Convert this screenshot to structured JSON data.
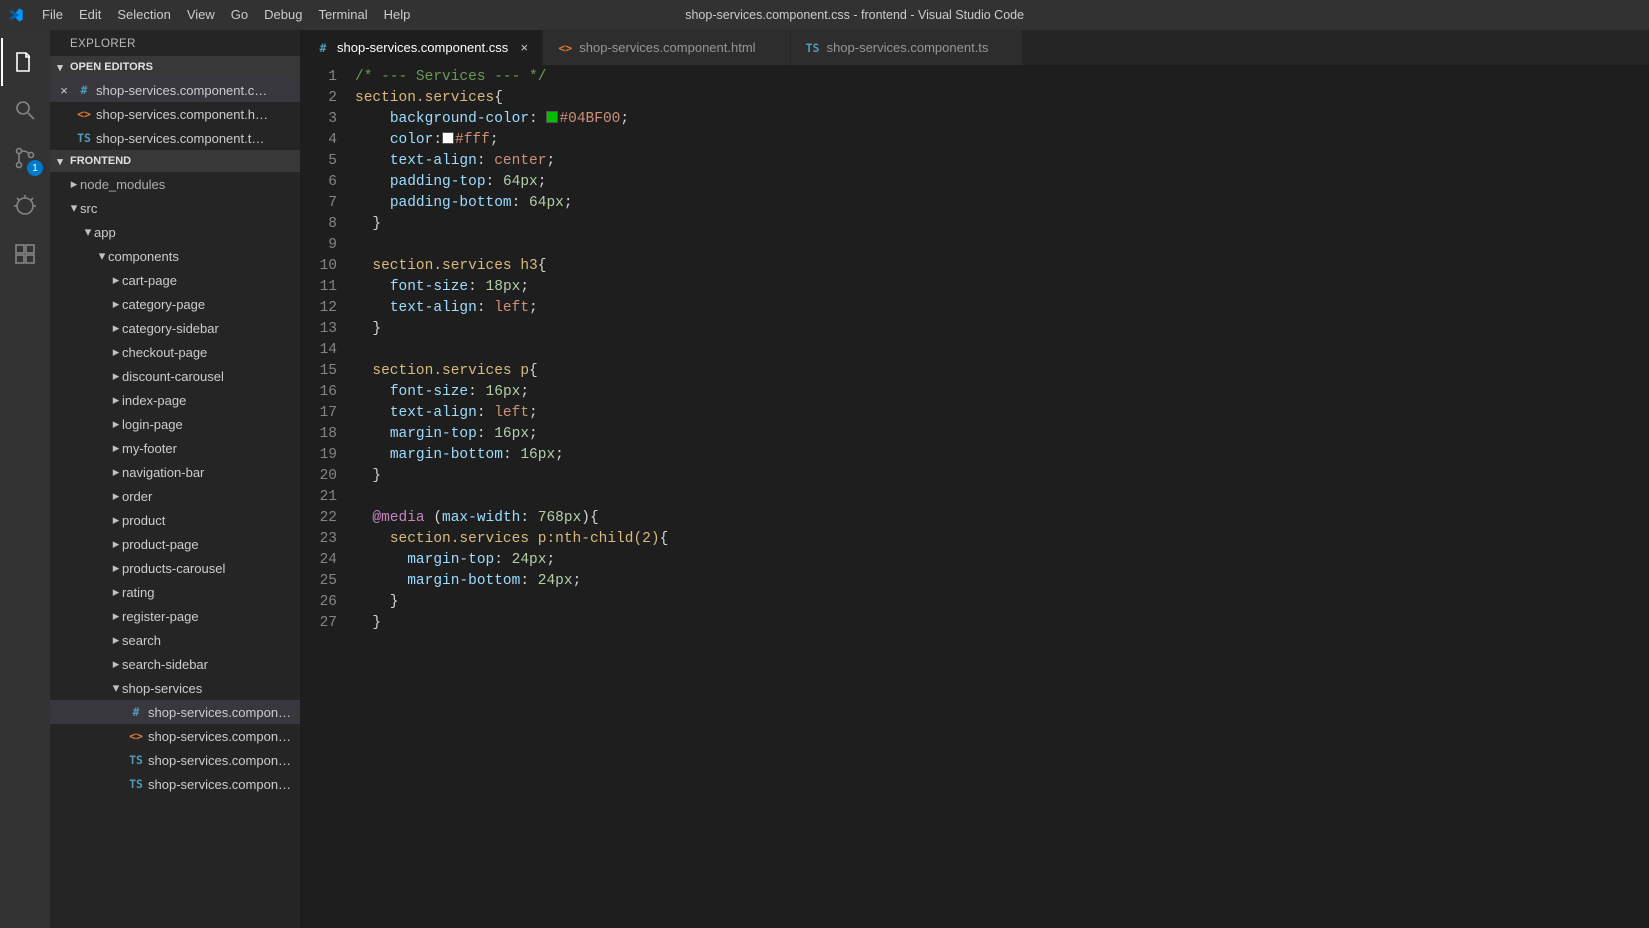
{
  "window_title": "shop-services.component.css - frontend - Visual Studio Code",
  "menu": [
    "File",
    "Edit",
    "Selection",
    "View",
    "Go",
    "Debug",
    "Terminal",
    "Help"
  ],
  "activity": {
    "scm_badge": "1"
  },
  "sidebar": {
    "explorer_label": "EXPLORER",
    "open_editors_label": "OPEN EDITORS",
    "project_label": "FRONTEND",
    "open_editors": [
      {
        "name": "shop-services.component.c…",
        "icon": "#",
        "icoClass": "ico-css",
        "modified": true
      },
      {
        "name": "shop-services.component.h…",
        "icon": "<>",
        "icoClass": "ico-html",
        "modified": false
      },
      {
        "name": "shop-services.component.t…",
        "icon": "TS",
        "icoClass": "ico-ts",
        "modified": false
      }
    ],
    "nodes": [
      {
        "depth": 1,
        "expand": "▸",
        "label": "node_modules",
        "kind": "folder",
        "muted": true
      },
      {
        "depth": 1,
        "expand": "▾",
        "label": "src",
        "kind": "folder"
      },
      {
        "depth": 2,
        "expand": "▾",
        "label": "app",
        "kind": "folder"
      },
      {
        "depth": 3,
        "expand": "▾",
        "label": "components",
        "kind": "folder"
      },
      {
        "depth": 4,
        "expand": "▸",
        "label": "cart-page",
        "kind": "folder"
      },
      {
        "depth": 4,
        "expand": "▸",
        "label": "category-page",
        "kind": "folder"
      },
      {
        "depth": 4,
        "expand": "▸",
        "label": "category-sidebar",
        "kind": "folder"
      },
      {
        "depth": 4,
        "expand": "▸",
        "label": "checkout-page",
        "kind": "folder"
      },
      {
        "depth": 4,
        "expand": "▸",
        "label": "discount-carousel",
        "kind": "folder"
      },
      {
        "depth": 4,
        "expand": "▸",
        "label": "index-page",
        "kind": "folder"
      },
      {
        "depth": 4,
        "expand": "▸",
        "label": "login-page",
        "kind": "folder"
      },
      {
        "depth": 4,
        "expand": "▸",
        "label": "my-footer",
        "kind": "folder"
      },
      {
        "depth": 4,
        "expand": "▸",
        "label": "navigation-bar",
        "kind": "folder"
      },
      {
        "depth": 4,
        "expand": "▸",
        "label": "order",
        "kind": "folder"
      },
      {
        "depth": 4,
        "expand": "▸",
        "label": "product",
        "kind": "folder"
      },
      {
        "depth": 4,
        "expand": "▸",
        "label": "product-page",
        "kind": "folder"
      },
      {
        "depth": 4,
        "expand": "▸",
        "label": "products-carousel",
        "kind": "folder"
      },
      {
        "depth": 4,
        "expand": "▸",
        "label": "rating",
        "kind": "folder"
      },
      {
        "depth": 4,
        "expand": "▸",
        "label": "register-page",
        "kind": "folder"
      },
      {
        "depth": 4,
        "expand": "▸",
        "label": "search",
        "kind": "folder"
      },
      {
        "depth": 4,
        "expand": "▸",
        "label": "search-sidebar",
        "kind": "folder"
      },
      {
        "depth": 4,
        "expand": "▾",
        "label": "shop-services",
        "kind": "folder"
      },
      {
        "depth": 5,
        "label": "shop-services.compon…",
        "kind": "file",
        "icon": "#",
        "icoClass": "ico-css",
        "selected": true
      },
      {
        "depth": 5,
        "label": "shop-services.compon…",
        "kind": "file",
        "icon": "<>",
        "icoClass": "ico-html"
      },
      {
        "depth": 5,
        "label": "shop-services.compon…",
        "kind": "file",
        "icon": "TS",
        "icoClass": "ico-ts"
      },
      {
        "depth": 5,
        "label": "shop-services.compon…",
        "kind": "file",
        "icon": "TS",
        "icoClass": "ico-ts"
      }
    ]
  },
  "tabs": [
    {
      "label": "shop-services.component.css",
      "icon": "#",
      "icoClass": "ico-css",
      "active": true
    },
    {
      "label": "shop-services.component.html",
      "icon": "<>",
      "icoClass": "ico-html",
      "active": false
    },
    {
      "label": "shop-services.component.ts",
      "icon": "TS",
      "icoClass": "ico-ts",
      "active": false
    }
  ],
  "code": {
    "line_count": 27,
    "lines": [
      [
        {
          "t": "/* --- Services --- */",
          "c": "tok-comment"
        }
      ],
      [
        {
          "t": "section.services",
          "c": "tok-selector"
        },
        {
          "t": "{",
          "c": "tok-punct"
        }
      ],
      [
        {
          "t": "    "
        },
        {
          "t": "background-color",
          "c": "tok-prop"
        },
        {
          "t": ": ",
          "c": "tok-punct"
        },
        {
          "swatch": "#04BF00"
        },
        {
          "t": "#04BF00",
          "c": "tok-val"
        },
        {
          "t": ";",
          "c": "tok-punct"
        }
      ],
      [
        {
          "t": "    "
        },
        {
          "t": "color",
          "c": "tok-prop"
        },
        {
          "t": ":",
          "c": "tok-punct"
        },
        {
          "swatch": "#ffffff"
        },
        {
          "t": "#fff",
          "c": "tok-val"
        },
        {
          "t": ";",
          "c": "tok-punct"
        }
      ],
      [
        {
          "t": "    "
        },
        {
          "t": "text-align",
          "c": "tok-prop"
        },
        {
          "t": ": ",
          "c": "tok-punct"
        },
        {
          "t": "center",
          "c": "tok-val"
        },
        {
          "t": ";",
          "c": "tok-punct"
        }
      ],
      [
        {
          "t": "    "
        },
        {
          "t": "padding-top",
          "c": "tok-prop"
        },
        {
          "t": ": ",
          "c": "tok-punct"
        },
        {
          "t": "64px",
          "c": "tok-num"
        },
        {
          "t": ";",
          "c": "tok-punct"
        }
      ],
      [
        {
          "t": "    "
        },
        {
          "t": "padding-bottom",
          "c": "tok-prop"
        },
        {
          "t": ": ",
          "c": "tok-punct"
        },
        {
          "t": "64px",
          "c": "tok-num"
        },
        {
          "t": ";",
          "c": "tok-punct"
        }
      ],
      [
        {
          "t": "  }",
          "c": "tok-punct"
        }
      ],
      [
        {
          "t": ""
        }
      ],
      [
        {
          "t": "  "
        },
        {
          "t": "section.services h3",
          "c": "tok-selector"
        },
        {
          "t": "{",
          "c": "tok-punct"
        }
      ],
      [
        {
          "t": "    "
        },
        {
          "t": "font-size",
          "c": "tok-prop"
        },
        {
          "t": ": ",
          "c": "tok-punct"
        },
        {
          "t": "18px",
          "c": "tok-num"
        },
        {
          "t": ";",
          "c": "tok-punct"
        }
      ],
      [
        {
          "t": "    "
        },
        {
          "t": "text-align",
          "c": "tok-prop"
        },
        {
          "t": ": ",
          "c": "tok-punct"
        },
        {
          "t": "left",
          "c": "tok-val"
        },
        {
          "t": ";",
          "c": "tok-punct"
        }
      ],
      [
        {
          "t": "  }",
          "c": "tok-punct"
        }
      ],
      [
        {
          "t": ""
        }
      ],
      [
        {
          "t": "  "
        },
        {
          "t": "section.services p",
          "c": "tok-selector"
        },
        {
          "t": "{",
          "c": "tok-punct"
        }
      ],
      [
        {
          "t": "    "
        },
        {
          "t": "font-size",
          "c": "tok-prop"
        },
        {
          "t": ": ",
          "c": "tok-punct"
        },
        {
          "t": "16px",
          "c": "tok-num"
        },
        {
          "t": ";",
          "c": "tok-punct"
        }
      ],
      [
        {
          "t": "    "
        },
        {
          "t": "text-align",
          "c": "tok-prop"
        },
        {
          "t": ": ",
          "c": "tok-punct"
        },
        {
          "t": "left",
          "c": "tok-val"
        },
        {
          "t": ";",
          "c": "tok-punct"
        }
      ],
      [
        {
          "t": "    "
        },
        {
          "t": "margin-top",
          "c": "tok-prop"
        },
        {
          "t": ": ",
          "c": "tok-punct"
        },
        {
          "t": "16px",
          "c": "tok-num"
        },
        {
          "t": ";",
          "c": "tok-punct"
        }
      ],
      [
        {
          "t": "    "
        },
        {
          "t": "margin-bottom",
          "c": "tok-prop"
        },
        {
          "t": ": ",
          "c": "tok-punct"
        },
        {
          "t": "16px",
          "c": "tok-num"
        },
        {
          "t": ";",
          "c": "tok-punct"
        }
      ],
      [
        {
          "t": "  }",
          "c": "tok-punct"
        }
      ],
      [
        {
          "t": ""
        }
      ],
      [
        {
          "t": "  "
        },
        {
          "t": "@media",
          "c": "tok-media"
        },
        {
          "t": " ("
        },
        {
          "t": "max-width",
          "c": "tok-prop"
        },
        {
          "t": ": "
        },
        {
          "t": "768px",
          "c": "tok-num"
        },
        {
          "t": "){",
          "c": "tok-punct"
        }
      ],
      [
        {
          "t": "    "
        },
        {
          "t": "section.services p:nth-child(2)",
          "c": "tok-selector"
        },
        {
          "t": "{",
          "c": "tok-punct"
        }
      ],
      [
        {
          "t": "      "
        },
        {
          "t": "margin-top",
          "c": "tok-prop"
        },
        {
          "t": ": ",
          "c": "tok-punct"
        },
        {
          "t": "24px",
          "c": "tok-num"
        },
        {
          "t": ";",
          "c": "tok-punct"
        }
      ],
      [
        {
          "t": "      "
        },
        {
          "t": "margin-bottom",
          "c": "tok-prop"
        },
        {
          "t": ": ",
          "c": "tok-punct"
        },
        {
          "t": "24px",
          "c": "tok-num"
        },
        {
          "t": ";",
          "c": "tok-punct"
        }
      ],
      [
        {
          "t": "    }",
          "c": "tok-punct"
        }
      ],
      [
        {
          "t": "  }",
          "c": "tok-punct"
        }
      ]
    ]
  }
}
